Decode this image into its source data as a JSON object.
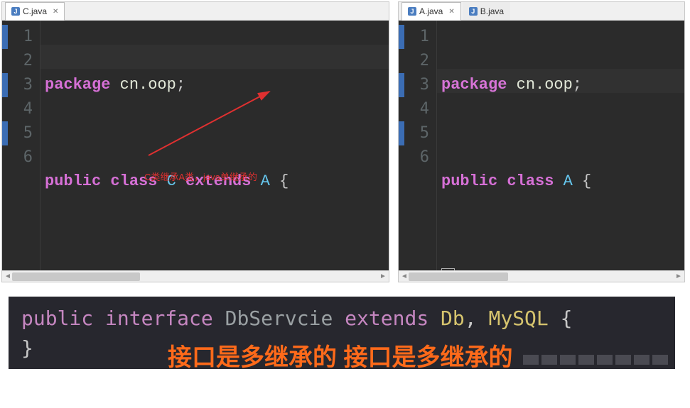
{
  "leftEditor": {
    "tab": {
      "icon": "J",
      "label": "C.java",
      "active": true
    },
    "lines": [
      "1",
      "2",
      "3",
      "4",
      "5",
      "6"
    ],
    "code1": {
      "kw1": "package",
      "pkg": "cn.oop",
      "semi": ";"
    },
    "code3": {
      "kw1": "public",
      "kw2": "class",
      "name": "C",
      "kw3": "extends",
      "super": "A",
      "brace": "{"
    },
    "code5": {
      "brace": "}"
    },
    "annotation": "C类继承A类，java单继承的"
  },
  "rightEditor": {
    "tabs": [
      {
        "icon": "J",
        "label": "A.java",
        "active": true
      },
      {
        "icon": "J",
        "label": "B.java",
        "active": false
      }
    ],
    "lines": [
      "1",
      "2",
      "3",
      "4",
      "5",
      "6"
    ],
    "code1": {
      "kw1": "package",
      "pkg": "cn.oop",
      "semi": ";"
    },
    "code3": {
      "kw1": "public",
      "kw2": "class",
      "name": "A",
      "brace": "{"
    },
    "code5": {
      "brace": "}"
    }
  },
  "bottom": {
    "code": {
      "kw1": "public",
      "kw2": "interface",
      "name": "DbServcie",
      "kw3": "extends",
      "t1": "Db",
      "comma": ",",
      "t2": "MySQL",
      "brace": "{"
    },
    "closebrace": "}",
    "note": "接口是多继承的"
  }
}
